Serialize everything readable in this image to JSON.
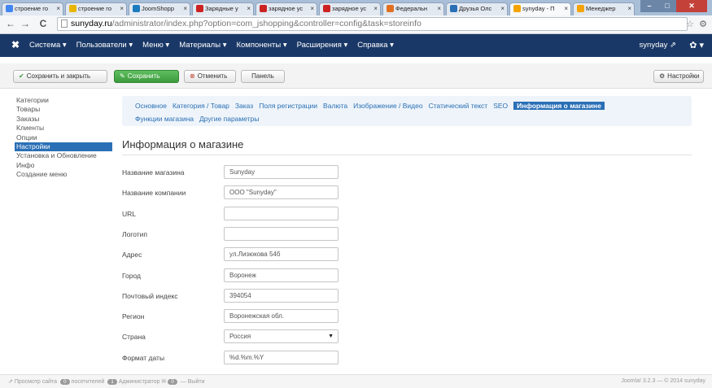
{
  "browser": {
    "tabs": [
      {
        "label": "строение го",
        "icon": "google-icon",
        "color": "#4285f4"
      },
      {
        "label": "строение го",
        "icon": "google-icon",
        "color": "#e8b500"
      },
      {
        "label": "JoomShopp",
        "icon": "joomshopping-icon",
        "color": "#1a7bbf"
      },
      {
        "label": "Зарядные у",
        "icon": "h1-icon",
        "color": "#cc2222"
      },
      {
        "label": "зарядное ус",
        "icon": "h1-icon",
        "color": "#cc2222"
      },
      {
        "label": "зарядное ус",
        "icon": "h1-icon",
        "color": "#cc2222"
      },
      {
        "label": "Федеральн",
        "icon": "globe-icon",
        "color": "#e07020"
      },
      {
        "label": "Друзья Олс",
        "icon": "ok-icon",
        "color": "#2a6fb6"
      },
      {
        "label": "synyday - П",
        "icon": "joomla-icon",
        "color": "#f4a300",
        "active": true
      },
      {
        "label": "Менеджер",
        "icon": "joomla-icon",
        "color": "#f4a300"
      }
    ],
    "url_host": "sunyday.ru",
    "url_path": "/administrator/index.php?option=com_jshopping&controller=config&task=storeinfo"
  },
  "navbar": {
    "menu": [
      "Система ▾",
      "Пользователи ▾",
      "Меню ▾",
      "Материалы ▾",
      "Компоненты ▾",
      "Расширения ▾",
      "Справка ▾"
    ],
    "user": "synyday ⇗",
    "gear": "✿ ▾"
  },
  "toolbar": {
    "save_close": "Сохранить и закрыть",
    "save": "Сохранить",
    "cancel": "Отменить",
    "panel": "Панель",
    "settings": "Настройки"
  },
  "sidebar": {
    "items": [
      "Категории",
      "Товары",
      "Заказы",
      "Клиенты",
      "Опции",
      "Настройки",
      "Установка и Обновление",
      "Инфо",
      "Создание меню"
    ],
    "active_index": 5
  },
  "tabs": {
    "row1": [
      "Основное",
      "Категория / Товар",
      "Заказ",
      "Поля регистрации",
      "Валюта",
      "Изображение / Видео",
      "Статический текст",
      "SEO",
      "Информация о магазине"
    ],
    "row2": [
      "Функции магазина",
      "Другие параметры"
    ],
    "active": "Информация о магазине"
  },
  "section_title": "Информация о магазине",
  "form": [
    {
      "label": "Название магазина",
      "value": "Sunyday"
    },
    {
      "label": "Название компании",
      "value": "ООО \"Sunyday\""
    },
    {
      "label": "URL",
      "value": ""
    },
    {
      "label": "Логотип",
      "value": ""
    },
    {
      "label": "Адрес",
      "value": "ул.Лизюкова 54б"
    },
    {
      "label": "Город",
      "value": "Воронеж"
    },
    {
      "label": "Почтовый индекс",
      "value": "394054"
    },
    {
      "label": "Регион",
      "value": "Воронежская обл."
    },
    {
      "label": "Страна",
      "value": "Россия",
      "select": true
    },
    {
      "label": "Формат даты",
      "value": "%d.%m.%Y"
    }
  ],
  "statusbar": {
    "view_site": "Просмотр сайта",
    "visitors_count": "0",
    "visitors": "посетителей",
    "admins_count": "1",
    "admins": "Администратор",
    "messages_count": "0",
    "logout": "Выйти",
    "version": "Joomla! 3.2.3 — © 2014 sunyday"
  }
}
